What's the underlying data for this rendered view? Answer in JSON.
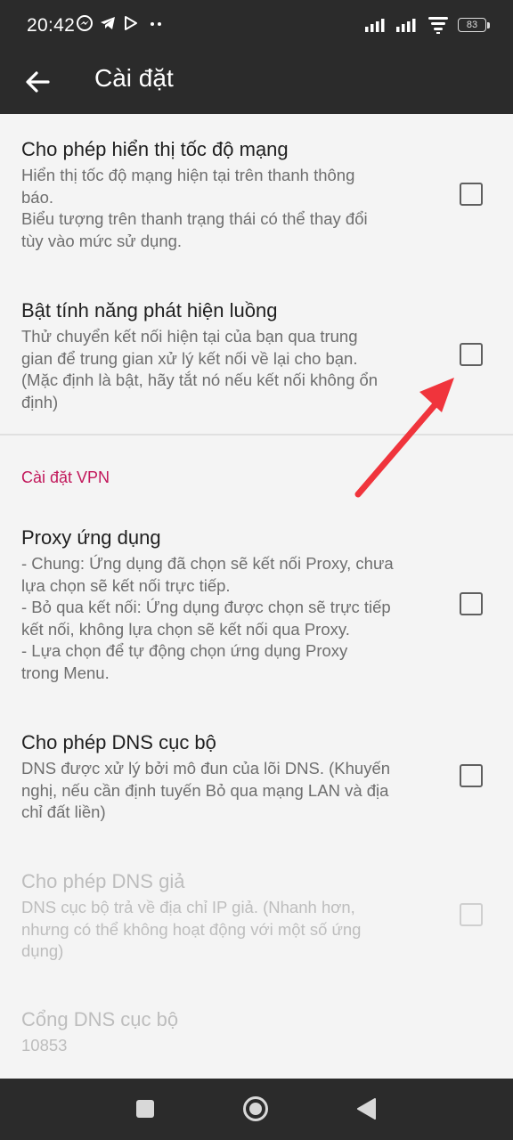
{
  "status_bar": {
    "time": "20:42",
    "battery": "83",
    "icons_left": [
      "messenger-icon",
      "telegram-icon",
      "play-store-icon",
      "more-dots-icon"
    ],
    "icons_right": [
      "signal-icon",
      "signal-icon",
      "wifi-icon",
      "battery-icon"
    ]
  },
  "app_bar": {
    "title": "Cài đặt"
  },
  "settings": [
    {
      "title": "Cho phép hiển thị tốc độ mạng",
      "lines": [
        "Hiển thị tốc độ mạng hiện tại trên thanh thông",
        "báo.",
        "Biểu tượng trên thanh trạng thái có thể thay đổi",
        "tùy vào mức sử dụng."
      ],
      "checked": false
    },
    {
      "title": "Bật tính năng phát hiện luồng",
      "lines": [
        "Thử chuyển kết nối hiện tại của bạn qua trung",
        "gian để trung gian xử lý kết nối về lại cho bạn.",
        "(Mặc định là bật, hãy tắt nó nếu kết nối không ổn",
        "định)"
      ],
      "checked": false
    }
  ],
  "vpn_section": {
    "header": "Cài đặt VPN",
    "items": [
      {
        "title": "Proxy ứng dụng",
        "lines": [
          "- Chung: Ứng dụng đã chọn sẽ kết nối Proxy, chưa",
          "lựa chọn sẽ kết nối trực tiếp.",
          "- Bỏ qua kết nối: Ứng dụng được chọn sẽ trực tiếp",
          "kết nối, không lựa chọn sẽ kết nối qua Proxy.",
          "- Lựa chọn để tự động chọn ứng dụng Proxy",
          "trong Menu."
        ],
        "checked": false
      },
      {
        "title": "Cho phép DNS cục bộ",
        "lines": [
          "DNS được xử lý bởi mô đun của lõi DNS. (Khuyến",
          "nghị, nếu cần định tuyến Bỏ qua mạng LAN và địa",
          "chỉ đất liền)"
        ],
        "checked": false
      },
      {
        "title": "Cho phép DNS giả",
        "lines": [
          "DNS cục bộ trả về địa chỉ IP giả. (Nhanh hơn,",
          "nhưng có thể không hoạt động với một số ứng",
          "dụng)"
        ],
        "checked": false,
        "enabled": false
      },
      {
        "title": "Cổng DNS cục bộ",
        "value": "10853",
        "enabled": false
      }
    ]
  },
  "colors": {
    "bar": "#2b2b2b",
    "background": "#f4f4f4",
    "accent": "#c2185b",
    "annotation_arrow": "#f0343c"
  }
}
